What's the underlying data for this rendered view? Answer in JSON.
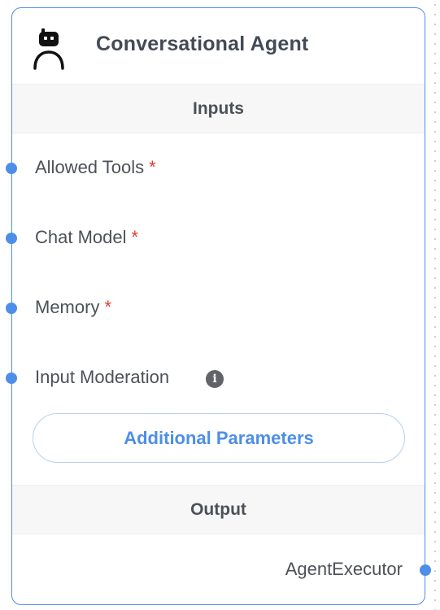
{
  "node": {
    "title": "Conversational Agent",
    "icon": "robot-icon"
  },
  "inputs_section": {
    "label": "Inputs"
  },
  "params": [
    {
      "label": "Allowed Tools",
      "required": true,
      "required_mark": "*"
    },
    {
      "label": "Chat Model",
      "required": true,
      "required_mark": "*"
    },
    {
      "label": "Memory",
      "required": true,
      "required_mark": "*"
    },
    {
      "label": "Input Moderation",
      "required": false,
      "info_icon": "info-icon",
      "info_glyph": "i"
    }
  ],
  "additional_params_button": {
    "label": "Additional Parameters"
  },
  "output_section": {
    "label": "Output"
  },
  "output": {
    "label": "AgentExecutor"
  },
  "colors": {
    "accent": "#4d8ee8",
    "required": "#e23b2e",
    "text": "#4d5158"
  }
}
